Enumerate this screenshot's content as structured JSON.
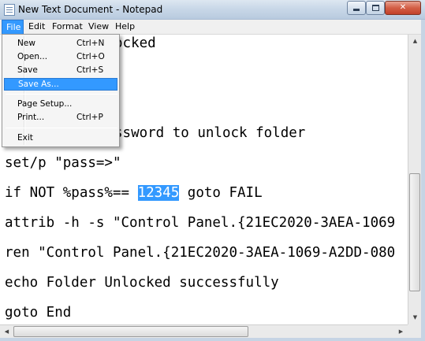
{
  "window": {
    "title": "New Text Document - Notepad",
    "controls": {
      "minimize_icon": "minimize-icon",
      "maximize_icon": "maximize-icon",
      "close_glyph": "✕"
    }
  },
  "menubar": {
    "items": [
      "File",
      "Edit",
      "Format",
      "View",
      "Help"
    ],
    "active": "File"
  },
  "file_menu": {
    "items": [
      {
        "label": "New",
        "shortcut": "Ctrl+N"
      },
      {
        "label": "Open...",
        "shortcut": "Ctrl+O"
      },
      {
        "label": "Save",
        "shortcut": "Ctrl+S"
      },
      {
        "label": "Save As...",
        "shortcut": ""
      },
      {
        "label": "Page Setup...",
        "shortcut": ""
      },
      {
        "label": "Print...",
        "shortcut": "Ctrl+P"
      },
      {
        "label": "Exit",
        "shortcut": ""
      }
    ],
    "highlighted": "Save As..."
  },
  "editor": {
    "lines": [
      {
        "text": "ocked"
      },
      {
        "text": "ssword to unlock folder"
      },
      {
        "text": "set/p \"pass=>\""
      },
      {
        "before": "if NOT %pass%== ",
        "selected": "12345",
        "after": " goto FAIL"
      },
      {
        "text": "attrib -h -s \"Control Panel.{21EC2020-3AEA-1069"
      },
      {
        "text": "ren \"Control Panel.{21EC2020-3AEA-1069-A2DD-080"
      },
      {
        "text": "echo Folder Unlocked successfully"
      },
      {
        "text": "goto End"
      }
    ]
  },
  "scrollbars": {
    "up_arrow": "▲",
    "down_arrow": "▼",
    "left_arrow": "◀",
    "right_arrow": "▶"
  },
  "colors": {
    "selection": "#3399ff",
    "menu_highlight": "#3399ff",
    "close_button": "#c2412a"
  }
}
